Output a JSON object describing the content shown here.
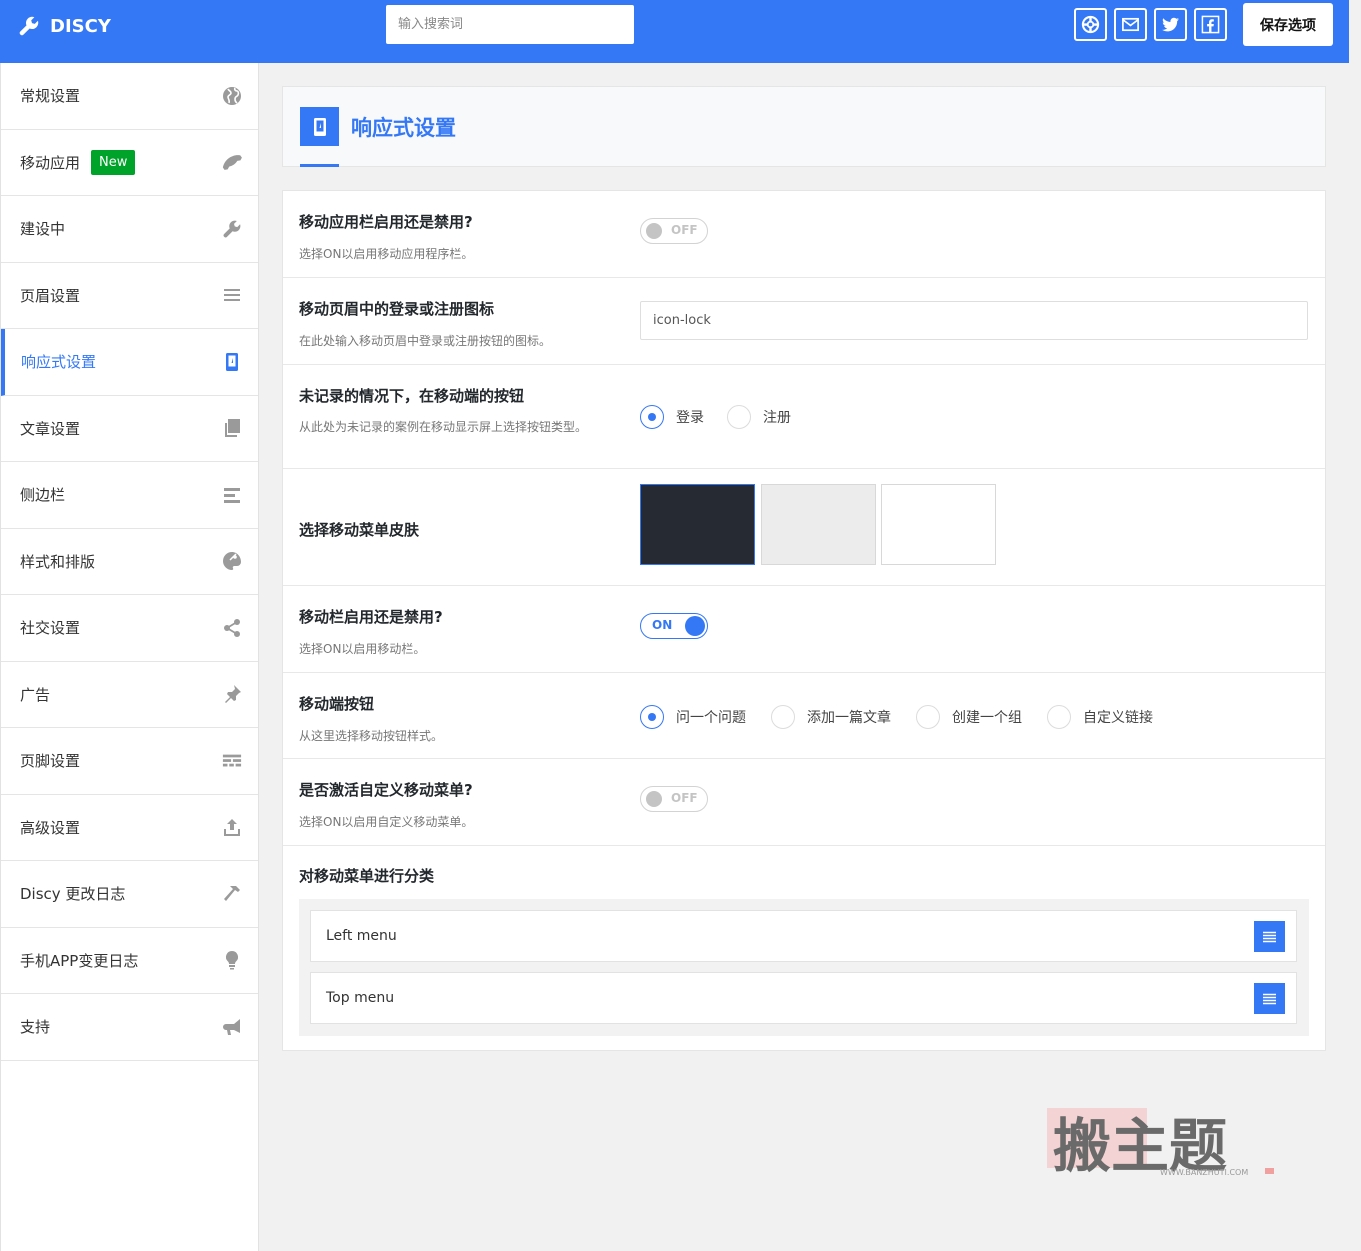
{
  "topbar": {
    "brand": "DISCY",
    "search_placeholder": "输入搜索词",
    "save_label": "保存选项",
    "icons": [
      "support-icon",
      "mail-icon",
      "twitter-icon",
      "facebook-icon"
    ],
    "accent_color": "#3478f6"
  },
  "sidebar": {
    "items": [
      {
        "label": "常规设置",
        "icon": "globe-icon"
      },
      {
        "label": "移动应用",
        "badge": "New",
        "icon": "phone-icon"
      },
      {
        "label": "建设中",
        "icon": "wrench-icon"
      },
      {
        "label": "页眉设置",
        "icon": "menu-icon"
      },
      {
        "label": "响应式设置",
        "icon": "mobile-icon",
        "active": true
      },
      {
        "label": "文章设置",
        "icon": "copy-icon"
      },
      {
        "label": "侧边栏",
        "icon": "align-icon"
      },
      {
        "label": "样式和排版",
        "icon": "palette-icon"
      },
      {
        "label": "社交设置",
        "icon": "share-icon"
      },
      {
        "label": "广告",
        "icon": "pin-icon"
      },
      {
        "label": "页脚设置",
        "icon": "footer-icon"
      },
      {
        "label": "高级设置",
        "icon": "upload-icon"
      },
      {
        "label": "Discy 更改日志",
        "icon": "hammer-icon"
      },
      {
        "label": "手机APP变更日志",
        "icon": "bulb-icon"
      },
      {
        "label": "支持",
        "icon": "megaphone-icon"
      }
    ]
  },
  "section": {
    "title": "响应式设置",
    "icon": "mobile-icon"
  },
  "settings": {
    "app_bar": {
      "label": "移动应用栏启用还是禁用?",
      "desc": "选择ON以启用移动应用程序栏。",
      "toggle": "OFF"
    },
    "login_icon": {
      "label": "移动页眉中的登录或注册图标",
      "desc": "在此处输入移动页眉中登录或注册按钮的图标。",
      "value": "icon-lock"
    },
    "not_logged": {
      "label": "未记录的情况下，在移动端的按钮",
      "desc": "从此处为未记录的案例在移动显示屏上选择按钮类型。",
      "options": [
        "登录",
        "注册"
      ],
      "selected": 0
    },
    "menu_skin": {
      "label": "选择移动菜单皮肤",
      "skins": [
        "#262a33",
        "#ececec",
        "#ffffff"
      ],
      "selected": 0
    },
    "mobile_bar": {
      "label": "移动栏启用还是禁用?",
      "desc": "选择ON以启用移动栏。",
      "toggle": "ON"
    },
    "mobile_button": {
      "label": "移动端按钮",
      "desc": "从这里选择移动按钮样式。",
      "options": [
        "问一个问题",
        "添加一篇文章",
        "创建一个组",
        "自定义链接"
      ],
      "selected": 0
    },
    "custom_menu": {
      "label": "是否激活自定义移动菜单?",
      "desc": "选择ON以启用自定义移动菜单。",
      "toggle": "OFF"
    },
    "sort_menu": {
      "label": "对移动菜单进行分类",
      "items": [
        "Left menu",
        "Top menu"
      ]
    }
  },
  "watermark": {
    "text": "搬主题",
    "url": "WWW.BANZHUTI.COM"
  }
}
